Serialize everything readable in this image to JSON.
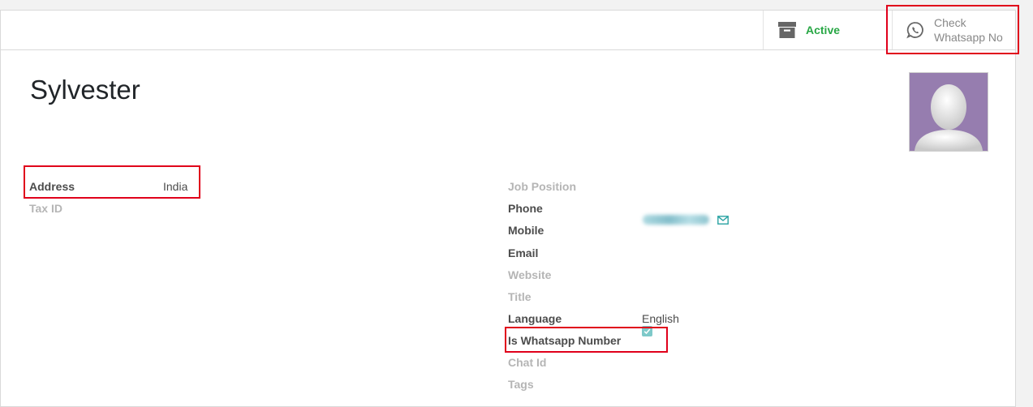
{
  "statusbar": {
    "active_label": "Active",
    "whatsapp_line1": "Check",
    "whatsapp_line2": "Whatsapp No"
  },
  "record": {
    "name": "Sylvester"
  },
  "left_fields": {
    "address_label": "Address",
    "address_value": "India",
    "tax_id_label": "Tax ID"
  },
  "right_fields": {
    "job_position_label": "Job Position",
    "phone_label": "Phone",
    "mobile_label": "Mobile",
    "email_label": "Email",
    "website_label": "Website",
    "title_label": "Title",
    "language_label": "Language",
    "language_value": "English",
    "is_whatsapp_label": "Is Whatsapp Number",
    "is_whatsapp_checked": true,
    "chat_id_label": "Chat Id",
    "tags_label": "Tags"
  },
  "colors": {
    "active_green": "#28a745",
    "avatar_bg": "#967daf",
    "highlight_red": "#e0001b",
    "checkbox_teal": "#7ec9c9"
  }
}
